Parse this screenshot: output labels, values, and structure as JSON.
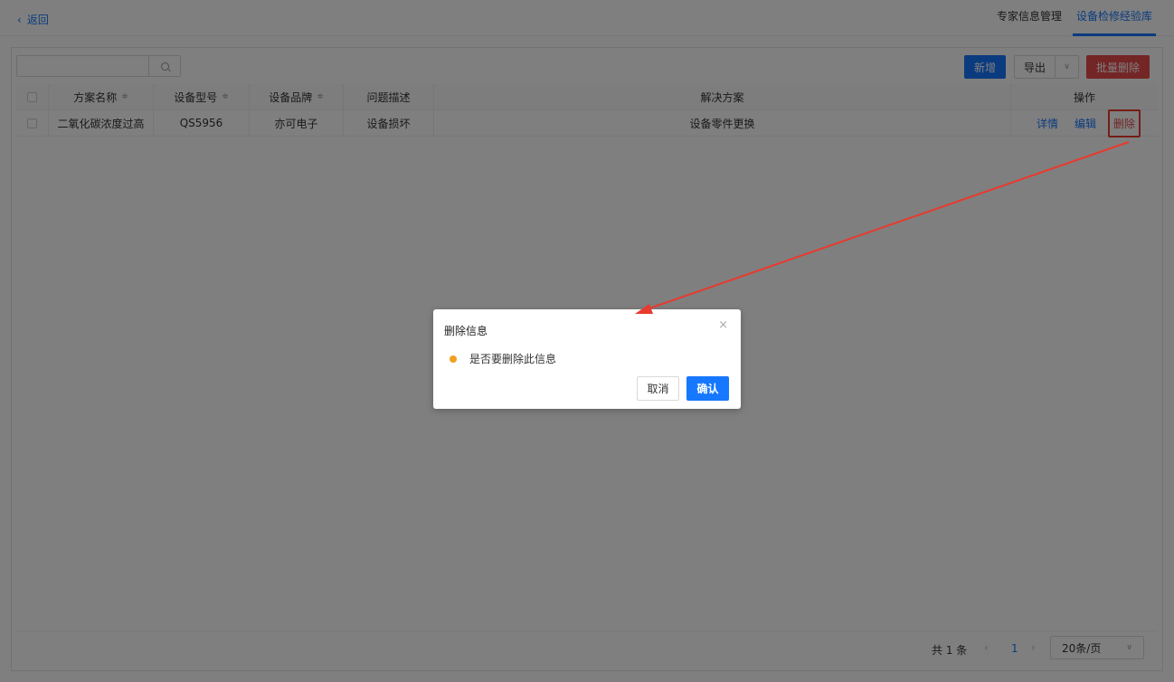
{
  "topbar": {
    "back_label": "返回",
    "tabs": [
      {
        "label": "专家信息管理",
        "active": false
      },
      {
        "label": "设备检修经验库",
        "active": true
      }
    ]
  },
  "toolbar": {
    "search_placeholder": "",
    "add_label": "新增",
    "export_label": "导出",
    "batch_delete_label": "批量删除"
  },
  "table": {
    "columns": [
      "方案名称",
      "设备型号",
      "设备品牌",
      "问题描述",
      "解决方案",
      "操作"
    ],
    "sortable_symbol": "≑",
    "rows": [
      {
        "name": "二氧化碳浓度过高",
        "model": "QS5956",
        "brand": "亦可电子",
        "problem": "设备损坏",
        "solution": "设备零件更换",
        "actions": [
          "详情",
          "编辑",
          "删除"
        ]
      }
    ]
  },
  "pagination": {
    "total_label": "共 1 条",
    "current_page": "1",
    "page_size": "20条/页"
  },
  "modal": {
    "title": "删除信息",
    "close": "×",
    "message": "是否要删除此信息",
    "cancel_label": "取消",
    "confirm_label": "确认"
  },
  "colors": {
    "primary": "#1677ff",
    "danger": "#e84a4a",
    "warning": "#f0a020",
    "annotation": "#e83a2e"
  }
}
